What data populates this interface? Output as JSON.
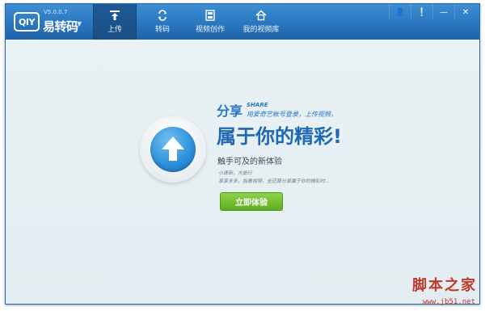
{
  "app": {
    "logo_text": "QIY",
    "version": "V5.0.0.7",
    "name": "易转码"
  },
  "nav": {
    "tabs": [
      {
        "label": "上传",
        "icon": "upload-icon",
        "active": true
      },
      {
        "label": "转码",
        "icon": "transcode-icon",
        "active": false
      },
      {
        "label": "视频创作",
        "icon": "film-icon",
        "active": false
      },
      {
        "label": "我的视频库",
        "icon": "home-icon",
        "active": false
      }
    ]
  },
  "window_controls": [
    {
      "icon": "user-icon",
      "glyph": "👤"
    },
    {
      "icon": "info-icon",
      "glyph": "❕"
    },
    {
      "icon": "minimize-icon",
      "glyph": "—"
    },
    {
      "icon": "close-icon",
      "glyph": "✕"
    }
  ],
  "promo": {
    "title_prefix": "分享",
    "share_en": "SHARE",
    "subtitle": "用爱奇艺帐号登录，上传视频，",
    "headline": "属于你的精彩!",
    "tagline": "触手可及的新体验",
    "note1": "小清新，大能行",
    "note2": "享享多多，指看视频，全还算分享属于你的精彩时…",
    "cta_label": "立即体验"
  },
  "watermark": {
    "text": "脚本之家",
    "url": "www.jb51.net"
  },
  "colors": {
    "titlebar": "#2a76c0",
    "content_bg": "#e8f0f3",
    "accent_blue": "#2478c6",
    "cta_green": "#6cbd2a",
    "watermark_red": "#c0392b"
  }
}
